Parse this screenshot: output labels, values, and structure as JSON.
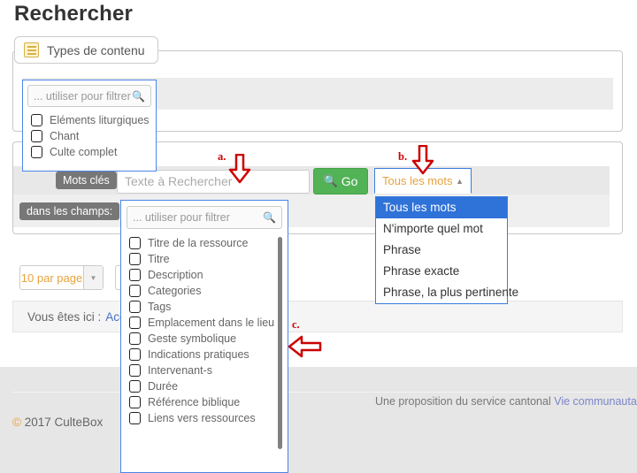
{
  "page": {
    "title": "Rechercher"
  },
  "types_fieldset": {
    "legend": "Types de contenu",
    "legend_icon": "document-lines-icon"
  },
  "types_filter_popup": {
    "placeholder": "... utiliser pour filtrer",
    "search_icon": "search-icon",
    "options": [
      "Eléments liturgiques",
      "Chant",
      "Culte complet"
    ]
  },
  "search_fieldset": {
    "keywords_label": "Mots clés",
    "fields_label": "dans les champs:",
    "keyword_placeholder": "Texte à Rechercher",
    "go_label": "Go",
    "go_icon": "search-icon"
  },
  "match_mode": {
    "selected": "Tous les mots",
    "caret_icon": "chevron-up-icon",
    "options": [
      "Tous les mots",
      "N'importe quel mot",
      "Phrase",
      "Phrase exacte",
      "Phrase, la plus pertinente"
    ]
  },
  "fields_filter_popup": {
    "placeholder": "... utiliser pour filtrer",
    "search_icon": "search-icon",
    "options": [
      "Titre de la ressource",
      "Titre",
      "Description",
      "Categories",
      "Tags",
      "Emplacement dans le lieu",
      "Geste symbolique",
      "Indications pratiques",
      "Intervenant-s",
      "Durée",
      "Référence biblique",
      "Liens vers ressources"
    ]
  },
  "toolbar": {
    "per_page": "10 par page",
    "per_page_caret": "chevron-down-icon"
  },
  "breadcrumb": {
    "prefix": "Vous êtes ici :",
    "home": "Acc"
  },
  "footer": {
    "copyright_symbol": "©",
    "copyright": "2017 CulteBox",
    "credit_text": "Une proposition du service cantonal",
    "credit_link": "Vie communautaire e"
  },
  "annotations": [
    {
      "label": "a.",
      "direction": "down"
    },
    {
      "label": "b.",
      "direction": "down"
    },
    {
      "label": "c.",
      "direction": "left"
    }
  ],
  "colors": {
    "accent_orange": "#e8a33d",
    "go_green": "#52b256",
    "popup_border_blue": "#4a86e8",
    "selection_blue": "#2f72d8",
    "annotation_red": "#cc0000"
  }
}
